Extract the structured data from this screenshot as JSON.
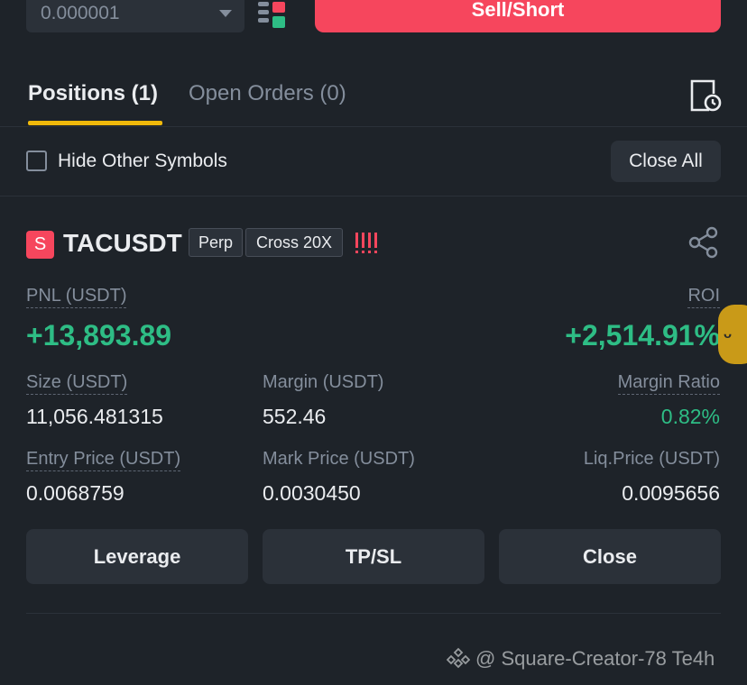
{
  "order_form": {
    "precision_value": "0.000001",
    "sell_label": "Sell/Short"
  },
  "tabs": {
    "positions_label": "Positions (1)",
    "open_orders_label": "Open Orders (0)"
  },
  "filter": {
    "hide_other_label": "Hide Other Symbols",
    "close_all_label": "Close All"
  },
  "position": {
    "side_badge": "S",
    "symbol": "TACUSDT",
    "contract_tag": "Perp",
    "margin_mode_tag": "Cross 20X",
    "pnl_label": "PNL (USDT)",
    "pnl_value": "+13,893.89",
    "roi_label": "ROI",
    "roi_value": "+2,514.91%",
    "size_label": "Size (USDT)",
    "size_value": "11,056.481315",
    "margin_label": "Margin (USDT)",
    "margin_value": "552.46",
    "margin_ratio_label": "Margin Ratio",
    "margin_ratio_value": "0.82%",
    "entry_label": "Entry Price (USDT)",
    "entry_value": "0.0068759",
    "mark_label": "Mark Price (USDT)",
    "mark_value": "0.0030450",
    "liq_label": "Liq.Price (USDT)",
    "liq_value": "0.0095656",
    "leverage_button": "Leverage",
    "tpsl_button": "TP/SL",
    "close_button": "Close"
  },
  "watermark": {
    "text": "@ Square-Creator-78 Te4h"
  },
  "colors": {
    "background": "#1e2329",
    "panel": "#2b3139",
    "sell_red": "#f6465d",
    "profit_green": "#2ebd85",
    "accent_yellow": "#f0b90b",
    "muted_text": "#848e9c"
  },
  "icons": {
    "precision_dropdown": "chevron-down-icon",
    "orderbook_toggle": "orderbook-layout-icon",
    "history": "order-history-icon",
    "share": "share-icon",
    "risk": "risk-level-icon"
  }
}
